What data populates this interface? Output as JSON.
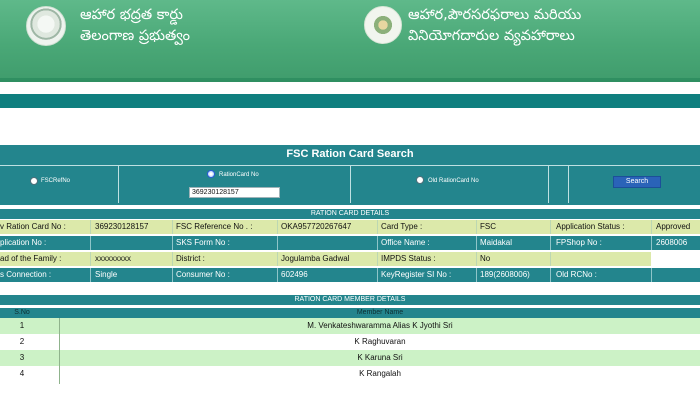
{
  "header": {
    "title_left": "ఆహార భద్రత కార్డు తెలంగాణ ప్రభుత్వం",
    "title_left_line1": "ఆహార భద్రత కార్డు",
    "title_left_line2": "తెలంగాణ ప్రభుత్వం",
    "title_right_line1": "ఆహార,పౌరసరఫరాలు మరియు",
    "title_right_line2": "వినియోగదారుల వ్యవహారాలు",
    "emblem_left": "telangana-emblem-icon",
    "emblem_right": "civil-supplies-emblem-icon"
  },
  "search": {
    "title": "FSC Ration Card Search",
    "options": [
      "FSCRefNo",
      "RationCard No",
      "Old RationCard No"
    ],
    "selected": "RationCard No",
    "rc_value": "369230128157",
    "button_label": "Search"
  },
  "details": {
    "title": "RATION CARD DETAILS",
    "rows": [
      [
        "v Ration Card No :",
        "369230128157",
        "FSC Reference No . :",
        "OKA957720267647",
        "Card Type :",
        "FSC",
        "Application Status :",
        "Approved"
      ],
      [
        "plication No :",
        "",
        "SKS Form No :",
        "",
        "Office Name :",
        "Maidakal",
        "FPShop No :",
        "2608006"
      ],
      [
        "ad of the Family :",
        "xxxxxxxxx",
        "District :",
        "Jogulamba Gadwal",
        "IMPDS Status :",
        "No",
        "",
        ""
      ],
      [
        "s Connection :",
        "Single",
        "Consumer No :",
        "602496",
        "KeyRegister SI No :",
        "189(2608006)",
        "Old RCNo :",
        ""
      ]
    ]
  },
  "members": {
    "title": "RATION CARD MEMBER DETAILS",
    "col_no": "S.No",
    "col_name": "Member Name",
    "rows": [
      {
        "no": "1",
        "name": "M. Venkateshwaramma Alias K Jyothi Sri"
      },
      {
        "no": "2",
        "name": "K Raghuvaran"
      },
      {
        "no": "3",
        "name": "K Karuna Sri"
      },
      {
        "no": "4",
        "name": "K Rangalah"
      }
    ]
  },
  "colors": {
    "header_green": "#4aa877",
    "teal": "#23858d",
    "row_green": "#dce9aa",
    "member_green": "#ccf2c6",
    "button_blue": "#2a63b8"
  }
}
